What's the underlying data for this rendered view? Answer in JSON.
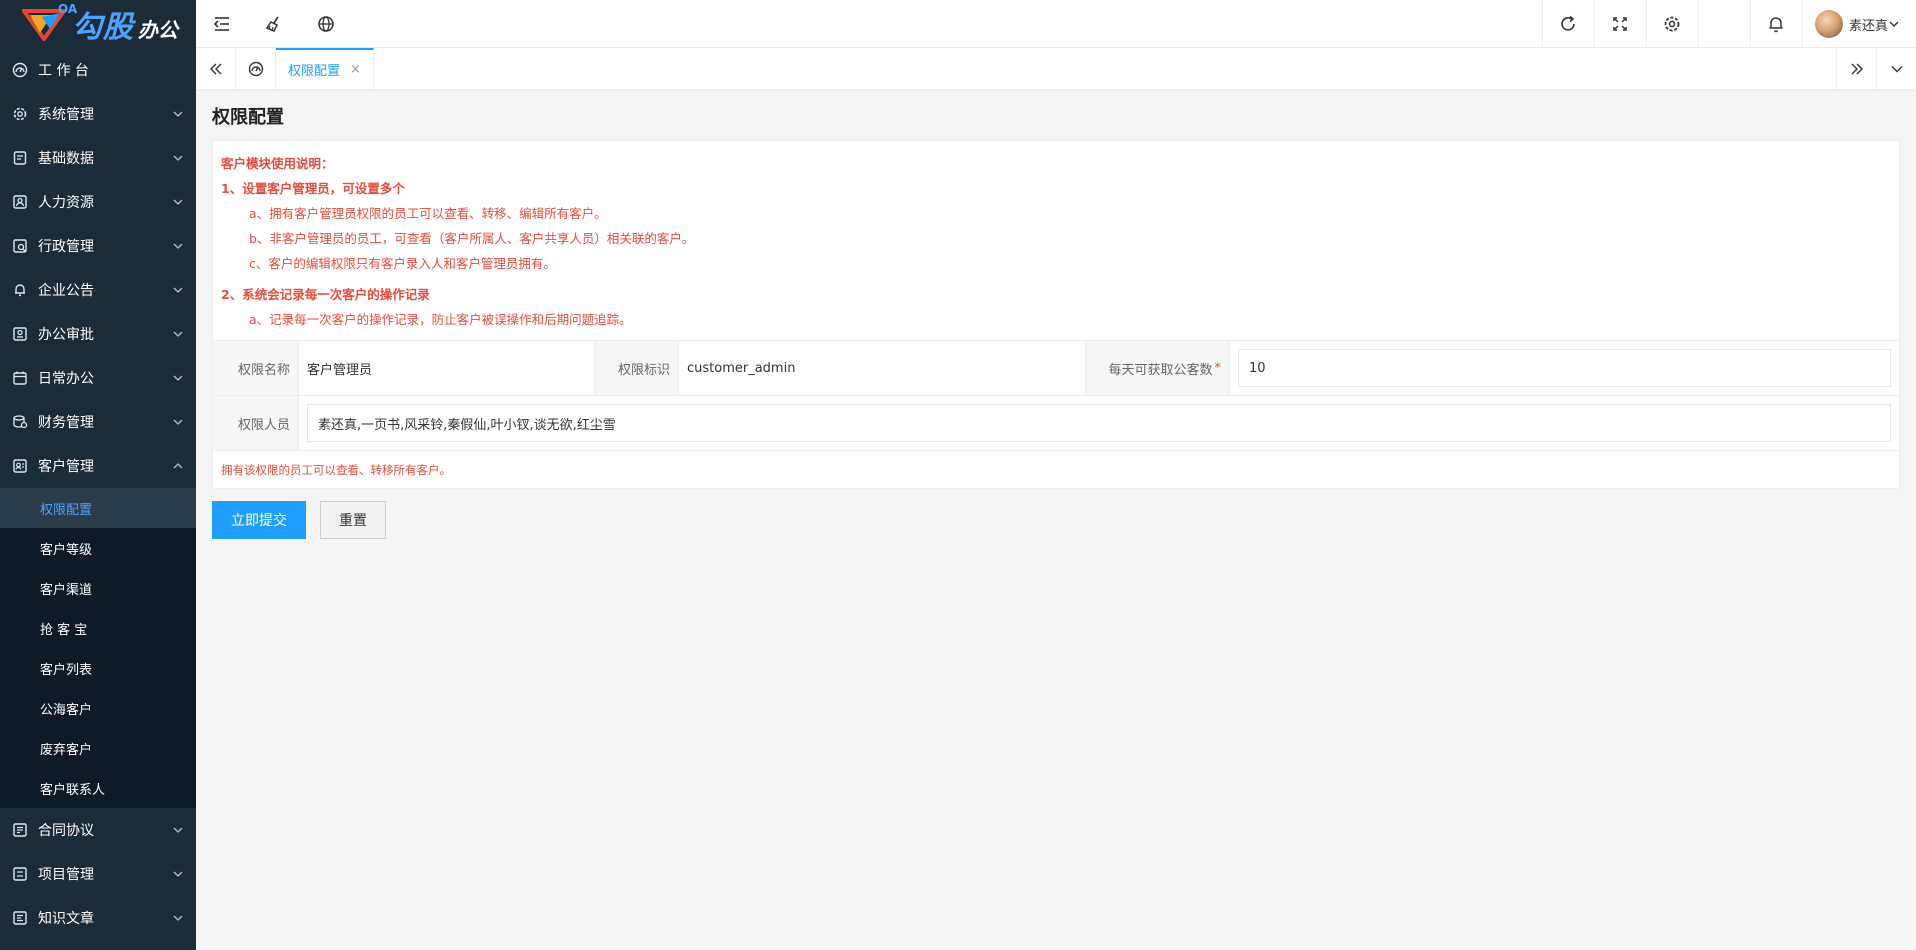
{
  "brand": {
    "small": "OA",
    "name": "勾股",
    "suffix": "办公"
  },
  "sidebar": {
    "items": [
      {
        "label": "工 作 台",
        "icon": "dashboard-icon"
      },
      {
        "label": "系统管理",
        "icon": "gear-icon"
      },
      {
        "label": "基础数据",
        "icon": "database-icon"
      },
      {
        "label": "人力资源",
        "icon": "user-card-icon"
      },
      {
        "label": "行政管理",
        "icon": "admin-icon"
      },
      {
        "label": "企业公告",
        "icon": "bell-icon"
      },
      {
        "label": "办公审批",
        "icon": "approval-icon"
      },
      {
        "label": "日常办公",
        "icon": "calendar-icon"
      },
      {
        "label": "财务管理",
        "icon": "finance-icon"
      },
      {
        "label": "客户管理",
        "icon": "customer-icon"
      }
    ],
    "customer_sub": [
      {
        "label": "权限配置"
      },
      {
        "label": "客户等级"
      },
      {
        "label": "客户渠道"
      },
      {
        "label": "抢 客 宝"
      },
      {
        "label": "客户列表"
      },
      {
        "label": "公海客户"
      },
      {
        "label": "废弃客户"
      },
      {
        "label": "客户联系人"
      }
    ],
    "items_after": [
      {
        "label": "合同协议",
        "icon": "contract-icon"
      },
      {
        "label": "项目管理",
        "icon": "project-icon"
      },
      {
        "label": "知识文章",
        "icon": "article-icon"
      }
    ]
  },
  "header": {
    "user_name": "素还真"
  },
  "tabs": {
    "active_label": "权限配置",
    "close_glyph": "×"
  },
  "page": {
    "title": "权限配置",
    "notice": {
      "heading": "客户模块使用说明：",
      "p1": "1、设置客户管理员，可设置多个",
      "p1a": "a、拥有客户管理员权限的员工可以查看、转移、编辑所有客户。",
      "p1b": "b、非客户管理员的员工，可查看（客户所属人、客户共享人员）相关联的客户。",
      "p1c": "c、客户的编辑权限只有客户录入人和客户管理员拥有。",
      "p2": "2、系统会记录每一次客户的操作记录",
      "p2a": "a、记录每一次客户的操作记录，防止客户被误操作和后期问题追踪。"
    },
    "form": {
      "name_label": "权限名称",
      "name_value": "客户管理员",
      "key_label": "权限标识",
      "key_value": "customer_admin",
      "daily_label": "每天可获取公客数",
      "required_mark": "*",
      "daily_value": "10",
      "members_label": "权限人员",
      "members_value": "素还真,一页书,风采铃,秦假仙,叶小钗,谈无欲,红尘雪",
      "hint": "拥有该权限的员工可以查看、转移所有客户。"
    },
    "actions": {
      "submit": "立即提交",
      "reset": "重置"
    }
  }
}
